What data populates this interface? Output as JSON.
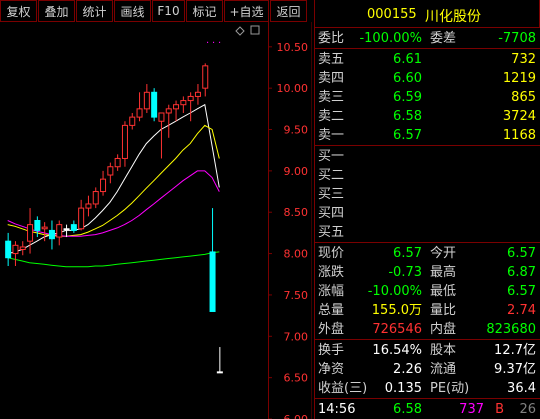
{
  "toolbar": {
    "buttons": [
      "复权",
      "叠加",
      "统计",
      "画线",
      "F10",
      "标记",
      "+自选",
      "返回"
    ]
  },
  "colors": {
    "up": "#ff3232",
    "down": "#00ffff",
    "flat": "#ffffff",
    "ma1": "#ffffff",
    "ma2": "#ffff00",
    "ma3": "#ff00ff",
    "ma4": "#00ff00",
    "grid": "#7a0000"
  },
  "stock": {
    "code": "000155",
    "name": "川化股份"
  },
  "weibi": {
    "label1": "委比",
    "value1": "-100.00%",
    "label2": "委差",
    "value2": "-7708"
  },
  "sell": [
    {
      "label": "卖五",
      "price": "6.61",
      "vol": "732"
    },
    {
      "label": "卖四",
      "price": "6.60",
      "vol": "1219"
    },
    {
      "label": "卖三",
      "price": "6.59",
      "vol": "865"
    },
    {
      "label": "卖二",
      "price": "6.58",
      "vol": "3724"
    },
    {
      "label": "卖一",
      "price": "6.57",
      "vol": "1168"
    }
  ],
  "buy": [
    {
      "label": "买一"
    },
    {
      "label": "买二"
    },
    {
      "label": "买三"
    },
    {
      "label": "买四"
    },
    {
      "label": "买五"
    }
  ],
  "stats": [
    {
      "l1": "现价",
      "v1": "6.57",
      "c1": "#00ff00",
      "l2": "今开",
      "v2": "6.57",
      "c2": "#00ff00"
    },
    {
      "l1": "涨跌",
      "v1": "-0.73",
      "c1": "#00ff00",
      "l2": "最高",
      "v2": "6.87",
      "c2": "#00ff00"
    },
    {
      "l1": "涨幅",
      "v1": "-10.00%",
      "c1": "#00ff00",
      "l2": "最低",
      "v2": "6.57",
      "c2": "#00ff00"
    },
    {
      "l1": "总量",
      "v1": "155.0万",
      "c1": "#ffff00",
      "l2": "量比",
      "v2": "2.74",
      "c2": "#ff3232"
    },
    {
      "l1": "外盘",
      "v1": "726546",
      "c1": "#ff3232",
      "l2": "内盘",
      "v2": "823680",
      "c2": "#00ff00"
    }
  ],
  "info": [
    {
      "l1": "换手",
      "v1": "16.54%",
      "l2": "股本",
      "v2": "12.7亿"
    },
    {
      "l1": "净资",
      "v1": "2.26",
      "l2": "流通",
      "v2": "9.37亿"
    },
    {
      "l1": "收益(三)",
      "v1": "0.135",
      "l2": "PE(动)",
      "v2": "36.4"
    }
  ],
  "tick": {
    "time": "14:56",
    "price": "6.58",
    "vol": "737",
    "side": "B",
    "count": "26"
  },
  "chart_data": {
    "type": "candlestick",
    "ylim": [
      6.0,
      10.8
    ],
    "yticks": [
      "10.50",
      "10.00",
      "9.50",
      "9.00",
      "8.50",
      "8.00",
      "7.50",
      "7.00",
      "6.50",
      "6.00"
    ],
    "candles": [
      {
        "o": 8.15,
        "h": 8.25,
        "l": 7.85,
        "c": 7.95
      },
      {
        "o": 8.0,
        "h": 8.15,
        "l": 7.85,
        "c": 8.1
      },
      {
        "o": 8.05,
        "h": 8.15,
        "l": 7.98,
        "c": 8.08
      },
      {
        "o": 8.15,
        "h": 8.55,
        "l": 8.0,
        "c": 8.35
      },
      {
        "o": 8.4,
        "h": 8.45,
        "l": 8.2,
        "c": 8.28
      },
      {
        "o": 8.3,
        "h": 8.38,
        "l": 8.15,
        "c": 8.32
      },
      {
        "o": 8.28,
        "h": 8.4,
        "l": 8.05,
        "c": 8.18
      },
      {
        "o": 8.2,
        "h": 8.4,
        "l": 8.1,
        "c": 8.35
      },
      {
        "o": 8.3,
        "h": 8.35,
        "l": 8.2,
        "c": 8.3
      },
      {
        "o": 8.35,
        "h": 8.4,
        "l": 8.25,
        "c": 8.28
      },
      {
        "o": 8.3,
        "h": 8.65,
        "l": 8.28,
        "c": 8.55
      },
      {
        "o": 8.55,
        "h": 8.7,
        "l": 8.45,
        "c": 8.6
      },
      {
        "o": 8.6,
        "h": 8.8,
        "l": 8.55,
        "c": 8.75
      },
      {
        "o": 8.75,
        "h": 9.0,
        "l": 8.7,
        "c": 8.9
      },
      {
        "o": 8.95,
        "h": 9.1,
        "l": 8.85,
        "c": 9.05
      },
      {
        "o": 9.05,
        "h": 9.2,
        "l": 9.0,
        "c": 9.15
      },
      {
        "o": 9.15,
        "h": 9.6,
        "l": 9.05,
        "c": 9.55
      },
      {
        "o": 9.55,
        "h": 9.7,
        "l": 9.5,
        "c": 9.65
      },
      {
        "o": 9.65,
        "h": 9.95,
        "l": 9.6,
        "c": 9.75
      },
      {
        "o": 9.75,
        "h": 10.05,
        "l": 9.7,
        "c": 9.95
      },
      {
        "o": 9.95,
        "h": 10.0,
        "l": 9.6,
        "c": 9.65
      },
      {
        "o": 9.6,
        "h": 9.7,
        "l": 9.15,
        "c": 9.7
      },
      {
        "o": 9.7,
        "h": 9.8,
        "l": 9.4,
        "c": 9.75
      },
      {
        "o": 9.75,
        "h": 9.85,
        "l": 9.6,
        "c": 9.8
      },
      {
        "o": 9.8,
        "h": 9.9,
        "l": 9.7,
        "c": 9.85
      },
      {
        "o": 9.85,
        "h": 9.95,
        "l": 9.6,
        "c": 9.9
      },
      {
        "o": 9.9,
        "h": 10.05,
        "l": 9.8,
        "c": 9.95
      },
      {
        "o": 10.0,
        "h": 10.3,
        "l": 9.9,
        "c": 10.27
      },
      {
        "o": 8.02,
        "h": 8.55,
        "l": 7.3,
        "c": 7.3
      },
      {
        "o": 6.57,
        "h": 6.87,
        "l": 6.57,
        "c": 6.57
      }
    ],
    "ma": [
      {
        "color": "#ffffff",
        "values": [
          8.0,
          8.02,
          8.05,
          8.1,
          8.15,
          8.2,
          8.23,
          8.25,
          8.28,
          8.28,
          8.3,
          8.35,
          8.43,
          8.52,
          8.62,
          8.75,
          8.9,
          9.05,
          9.2,
          9.33,
          9.42,
          9.5,
          9.55,
          9.6,
          9.65,
          9.7,
          9.75,
          9.8,
          9.3,
          8.8
        ]
      },
      {
        "color": "#ffff00",
        "values": [
          8.35,
          8.33,
          8.3,
          8.27,
          8.25,
          8.23,
          8.22,
          8.21,
          8.21,
          8.22,
          8.23,
          8.26,
          8.3,
          8.34,
          8.4,
          8.46,
          8.53,
          8.61,
          8.7,
          8.79,
          8.88,
          8.97,
          9.06,
          9.15,
          9.25,
          9.33,
          9.45,
          9.55,
          9.5,
          9.15
        ]
      },
      {
        "color": "#ff00ff",
        "values": [
          8.4,
          8.36,
          8.33,
          8.3,
          8.27,
          8.25,
          8.23,
          8.22,
          8.21,
          8.21,
          8.21,
          8.22,
          8.23,
          8.25,
          8.28,
          8.31,
          8.35,
          8.4,
          8.46,
          8.53,
          8.6,
          8.67,
          8.74,
          8.81,
          8.88,
          8.94,
          9.0,
          9.0,
          8.92,
          8.75
        ]
      },
      {
        "color": "#00ff00",
        "values": [
          7.95,
          7.93,
          7.91,
          7.89,
          7.88,
          7.87,
          7.86,
          7.85,
          7.84,
          7.84,
          7.84,
          7.84,
          7.85,
          7.85,
          7.86,
          7.87,
          7.88,
          7.89,
          7.9,
          7.91,
          7.92,
          7.93,
          7.94,
          7.95,
          7.96,
          7.97,
          7.98,
          7.99,
          8.01,
          8.02
        ]
      }
    ]
  }
}
